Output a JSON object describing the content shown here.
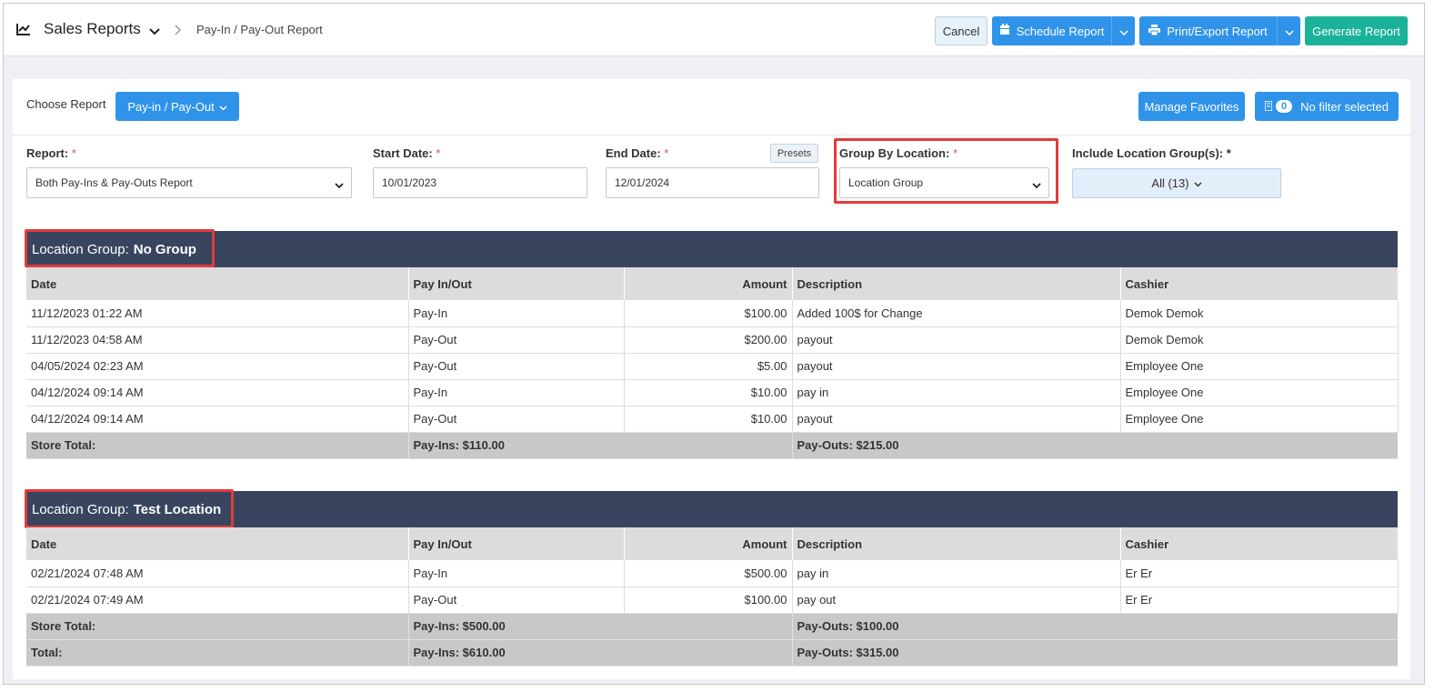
{
  "header": {
    "title": "Sales Reports",
    "breadcrumb": "Pay-In / Pay-Out Report",
    "buttons": {
      "cancel": "Cancel",
      "schedule": "Schedule Report",
      "print": "Print/Export Report",
      "generate": "Generate Report"
    }
  },
  "filters": {
    "choose_report_label": "Choose Report",
    "choose_report_value": "Pay-in / Pay-Out",
    "manage_favorites": "Manage Favorites",
    "filter_count": "0",
    "filter_text": "No filter selected",
    "report_label": "Report:",
    "report_value": "Both Pay-Ins & Pay-Outs Report",
    "start_label": "Start Date:",
    "start_value": "10/01/2023",
    "end_label": "End Date:",
    "end_value": "12/01/2024",
    "presets": "Presets",
    "group_label": "Group By Location:",
    "group_value": "Location Group",
    "include_label": "Include Location Group(s): *",
    "include_value": "All (13)",
    "required_mark": "*"
  },
  "columns": [
    "Date",
    "Pay In/Out",
    "Amount",
    "Description",
    "Cashier"
  ],
  "groups": [
    {
      "prefix": "Location Group:",
      "name": "No Group",
      "rows": [
        [
          "11/12/2023 01:22 AM",
          "Pay-In",
          "$100.00",
          "Added 100$ for Change",
          "Demok Demok"
        ],
        [
          "11/12/2023 04:58 AM",
          "Pay-Out",
          "$200.00",
          "payout",
          "Demok Demok"
        ],
        [
          "04/05/2024 02:23 AM",
          "Pay-Out",
          "$5.00",
          "payout",
          "Employee One"
        ],
        [
          "04/12/2024 09:14 AM",
          "Pay-In",
          "$10.00",
          "pay in",
          "Employee One"
        ],
        [
          "04/12/2024 09:14 AM",
          "Pay-Out",
          "$10.00",
          "payout",
          "Employee One"
        ]
      ],
      "store_total": {
        "label": "Store Total:",
        "pay_ins": "Pay-Ins: $110.00",
        "pay_outs": "Pay-Outs: $215.00"
      }
    },
    {
      "prefix": "Location Group:",
      "name": "Test Location",
      "rows": [
        [
          "02/21/2024 07:48 AM",
          "Pay-In",
          "$500.00",
          "pay in",
          "Er Er"
        ],
        [
          "02/21/2024 07:49 AM",
          "Pay-Out",
          "$100.00",
          "pay out",
          "Er Er"
        ]
      ],
      "store_total": {
        "label": "Store Total:",
        "pay_ins": "Pay-Ins: $500.00",
        "pay_outs": "Pay-Outs: $100.00"
      }
    }
  ],
  "grand_total": {
    "label": "Total:",
    "pay_ins": "Pay-Ins: $610.00",
    "pay_outs": "Pay-Outs: $315.00"
  },
  "colors": {
    "primary": "#2f93ea",
    "success": "#1ab29a",
    "group_header": "#39455e",
    "highlight": "#e03c3c"
  }
}
